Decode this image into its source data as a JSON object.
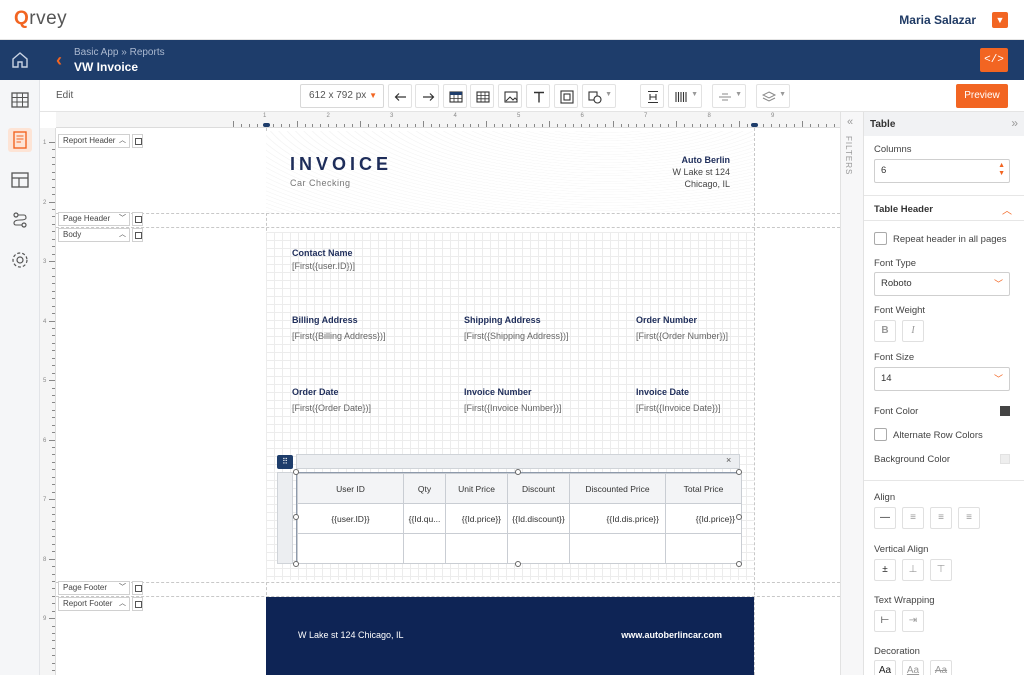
{
  "app": {
    "logo": "Qrvey",
    "user": "Maria Salazar"
  },
  "header": {
    "breadcrumb": "Basic App » Reports",
    "title": "VW Invoice",
    "code_label": "</>"
  },
  "toolbar": {
    "mode": "Edit",
    "page_size": "612 x 792 px",
    "preview_label": "Preview"
  },
  "ruler": {
    "top": [
      "1",
      "2",
      "3",
      "4",
      "5",
      "6",
      "7",
      "8",
      "9"
    ],
    "left": [
      "1",
      "2",
      "3",
      "4",
      "5",
      "6",
      "7",
      "8",
      "9"
    ]
  },
  "bands": {
    "report_header": "Report Header",
    "page_header": "Page Header",
    "body": "Body",
    "page_footer": "Page Footer",
    "report_footer": "Report Footer"
  },
  "invoice": {
    "title": "INVOICE",
    "subtitle": "Car Checking",
    "company": "Auto Berlin",
    "street": "W Lake st 124",
    "city": "Chicago, IL"
  },
  "fields": {
    "contact_label": "Contact Name",
    "contact_value": "[First({user.ID})]",
    "billing_label": "Billing Address",
    "billing_value": "[First({Billing Address})]",
    "shipping_label": "Shipping Address",
    "shipping_value": "[First({Shipping Address})]",
    "order_number_label": "Order Number",
    "order_number_value": "[First({Order Number})]",
    "order_date_label": "Order Date",
    "order_date_value": "[First({Order Date})]",
    "invoice_number_label": "Invoice Number",
    "invoice_number_value": "[First({Invoice Number})]",
    "invoice_date_label": "Invoice Date",
    "invoice_date_value": "[First({Invoice Date})]"
  },
  "table": {
    "columns": [
      "User ID",
      "Qty",
      "Unit Price",
      "Discount",
      "Discounted Price",
      "Total Price"
    ],
    "row": [
      "{{user.ID}}",
      "{{Id.qu...",
      "{{Id.price}}",
      "{{Id.discount}}",
      "{{Id.dis.price}}",
      "{{Id.price}}"
    ],
    "close": "×"
  },
  "footer": {
    "address": "W Lake st 124 Chicago, IL",
    "website": "www.autoberlincar.com"
  },
  "filters": {
    "label": "FILTERS"
  },
  "panel": {
    "title": "Table",
    "columns_label": "Columns",
    "columns_value": "6",
    "section_title": "Table Header",
    "repeat_header": "Repeat header in all pages",
    "font_type_label": "Font Type",
    "font_type_value": "Roboto",
    "font_weight_label": "Font Weight",
    "font_size_label": "Font Size",
    "font_size_value": "14",
    "font_color_label": "Font Color",
    "font_color": "#444444",
    "alt_rows": "Alternate Row Colors",
    "bg_color_label": "Background Color",
    "bg_color": "#eeeeee",
    "align_label": "Align",
    "valign_label": "Vertical Align",
    "wrap_label": "Text Wrapping",
    "decoration_label": "Decoration",
    "decoration_sample": "Aa"
  },
  "colors": {
    "brand_orange": "#f26522",
    "navy": "#1e3d6b",
    "footer_navy": "#0e2455"
  }
}
